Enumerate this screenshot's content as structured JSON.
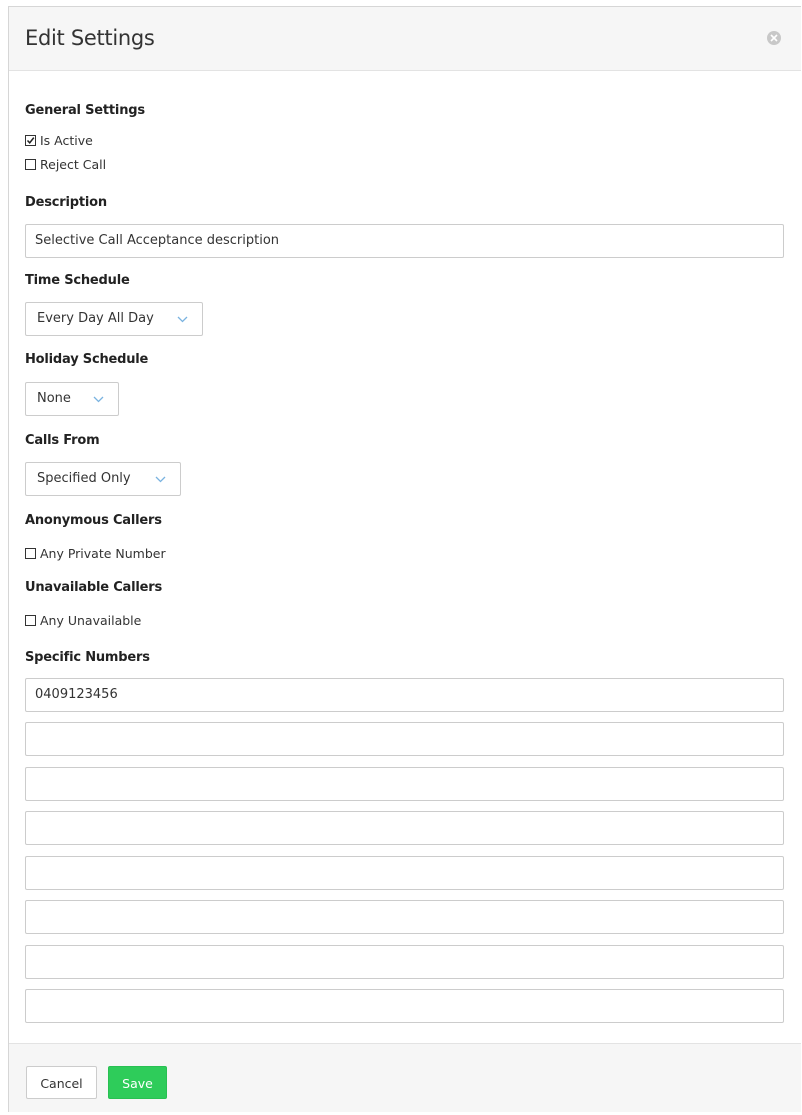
{
  "modal": {
    "title": "Edit Settings",
    "close_icon": "close-circle-icon"
  },
  "general": {
    "label": "General Settings",
    "is_active": {
      "label": "Is Active",
      "checked": true
    },
    "reject_call": {
      "label": "Reject Call",
      "checked": false
    }
  },
  "description": {
    "label": "Description",
    "value": "Selective Call Acceptance description"
  },
  "time_schedule": {
    "label": "Time Schedule",
    "selected": "Every Day All Day"
  },
  "holiday_schedule": {
    "label": "Holiday Schedule",
    "selected": "None"
  },
  "calls_from": {
    "label": "Calls From",
    "selected": "Specified Only"
  },
  "anonymous_callers": {
    "label": "Anonymous Callers",
    "any_private": {
      "label": "Any Private Number",
      "checked": false
    }
  },
  "unavailable_callers": {
    "label": "Unavailable Callers",
    "any_unavailable": {
      "label": "Any Unavailable",
      "checked": false
    }
  },
  "specific_numbers": {
    "label": "Specific Numbers",
    "values": [
      "0409123456",
      "",
      "",
      "",
      "",
      "",
      "",
      ""
    ]
  },
  "footer": {
    "cancel_label": "Cancel",
    "save_label": "Save"
  },
  "colors": {
    "save": "#2ecc5a",
    "header_bg": "#f6f6f6",
    "chevron": "#7ab3e0"
  }
}
